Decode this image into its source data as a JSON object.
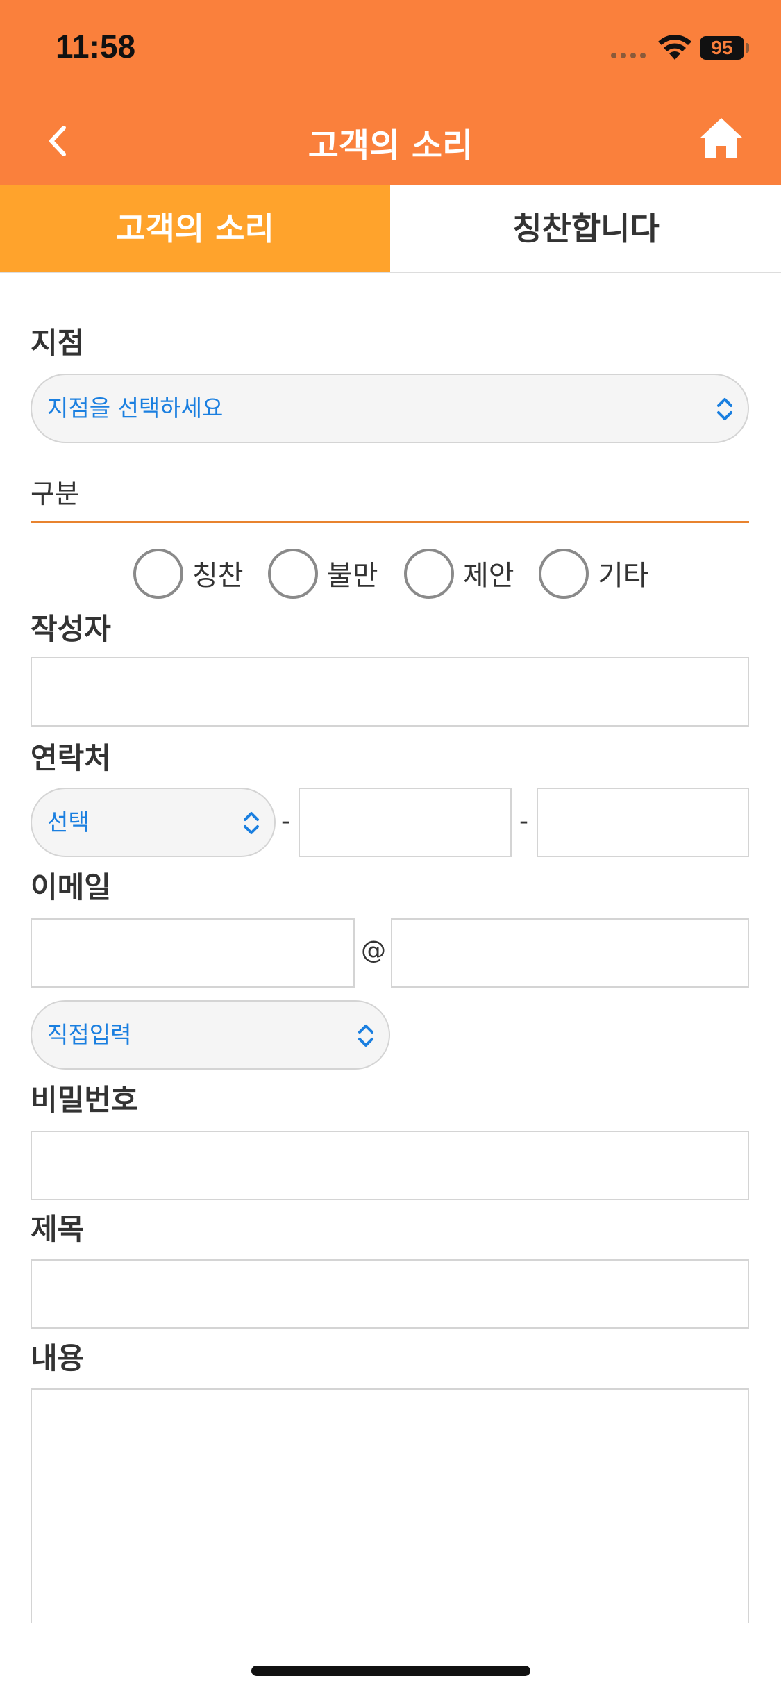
{
  "status_bar": {
    "time": "11:58",
    "battery": "95"
  },
  "nav": {
    "title": "고객의 소리",
    "back_icon": "chevron-left-icon",
    "home_icon": "home-icon"
  },
  "tabs": [
    {
      "label": "고객의 소리",
      "active": true
    },
    {
      "label": "칭찬합니다",
      "active": false
    }
  ],
  "form": {
    "branch": {
      "label": "지점",
      "selected": "지점을 선택하세요"
    },
    "division": {
      "label": "구분",
      "options": [
        "칭찬",
        "불만",
        "제안",
        "기타"
      ]
    },
    "author": {
      "label": "작성자",
      "value": ""
    },
    "contact": {
      "label": "연락처",
      "prefix_selected": "선택",
      "separator": "-",
      "part2": "",
      "part3": ""
    },
    "email": {
      "label": "이메일",
      "at": "@",
      "domain_selected": "직접입력",
      "local": "",
      "domain": ""
    },
    "password": {
      "label": "비밀번호",
      "value": ""
    },
    "subject": {
      "label": "제목",
      "value": ""
    },
    "content": {
      "label": "내용",
      "value": ""
    }
  },
  "colors": {
    "header": "#fa803c",
    "active_tab": "#ffa32c",
    "link_blue": "#1a7fe0",
    "underline": "#e8832f"
  }
}
